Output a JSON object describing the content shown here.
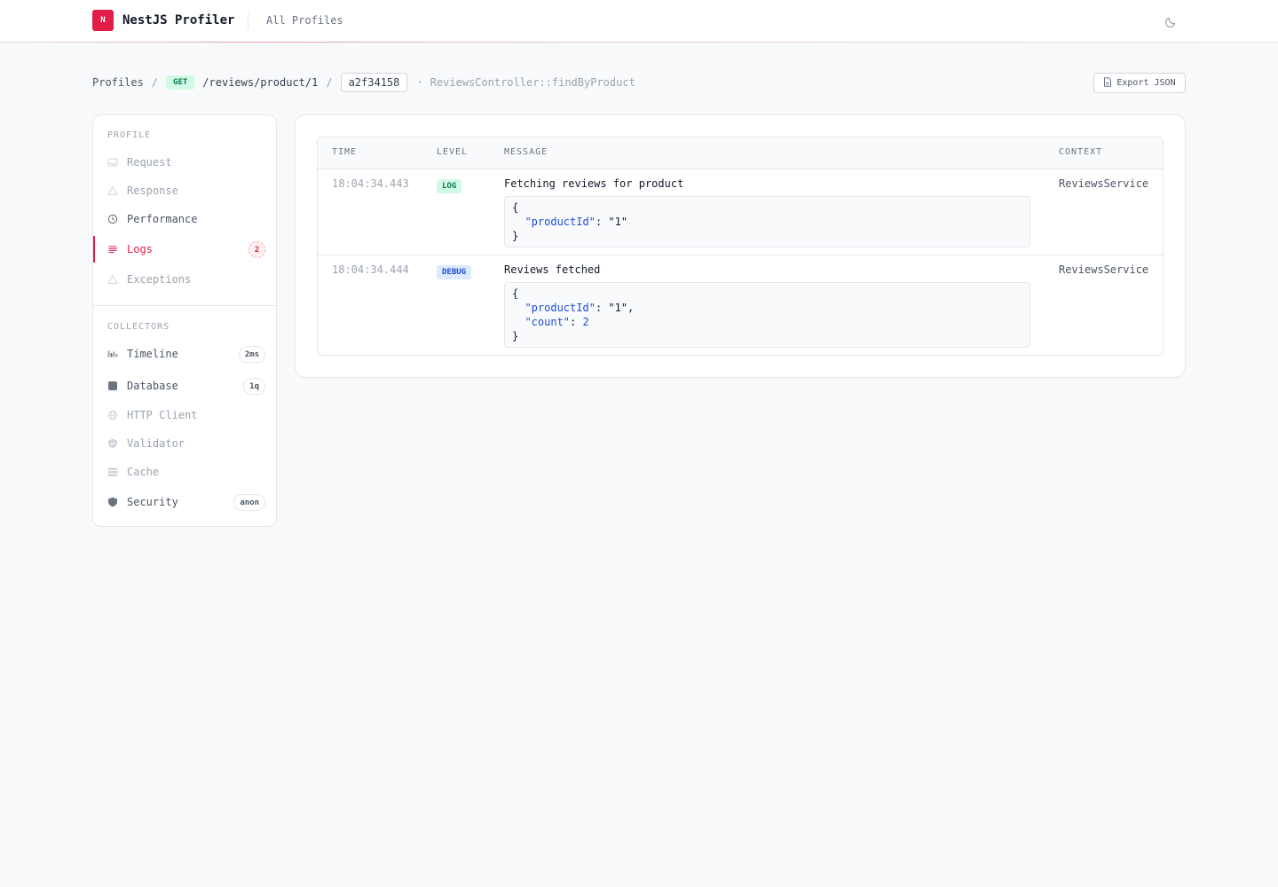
{
  "header": {
    "logo_letter": "N",
    "app_title": "NestJS Profiler",
    "nav_all_profiles": "All Profiles",
    "theme_icon": "moon-icon"
  },
  "breadcrumb": {
    "profiles": "Profiles",
    "sep": "/",
    "method": "GET",
    "path": "/reviews/product/1",
    "token": "a2f34158",
    "dot": "·",
    "handler": "ReviewsController::findByProduct"
  },
  "export_button": {
    "label": "Export JSON",
    "icon": "file-icon"
  },
  "sidebar": {
    "profile_heading": "PROFILE",
    "profile_items": [
      {
        "label": "Request",
        "icon": "inbox-icon"
      },
      {
        "label": "Response",
        "icon": "triangle-icon"
      },
      {
        "label": "Performance",
        "icon": "clock-icon"
      },
      {
        "label": "Logs",
        "icon": "list-icon",
        "badge": "2",
        "active": true
      },
      {
        "label": "Exceptions",
        "icon": "warning-icon"
      }
    ],
    "collectors_heading": "COLLECTORS",
    "collector_items": [
      {
        "label": "Timeline",
        "icon": "timeline-icon",
        "badge": "2ms"
      },
      {
        "label": "Database",
        "icon": "database-icon",
        "badge": "1q"
      },
      {
        "label": "HTTP Client",
        "icon": "globe-icon"
      },
      {
        "label": "Validator",
        "icon": "shield-check-icon"
      },
      {
        "label": "Cache",
        "icon": "layers-icon"
      },
      {
        "label": "Security",
        "icon": "shield-icon",
        "badge": "anon"
      }
    ]
  },
  "logs_table": {
    "columns": [
      "TIME",
      "LEVEL",
      "MESSAGE",
      "CONTEXT"
    ],
    "rows": [
      {
        "time": "18:04:34.443",
        "level": "LOG",
        "message": "Fetching reviews for product",
        "context": "ReviewsService",
        "payload_lines": [
          "{",
          "\"productId\"",
          ": \"1\"",
          "}"
        ]
      },
      {
        "time": "18:04:34.444",
        "level": "DEBUG",
        "message": "Reviews fetched",
        "context": "ReviewsService",
        "payload_lines": [
          "{",
          "\"productId\"",
          ": \"1\",",
          "\"count\"",
          ": ",
          "2",
          "}"
        ]
      }
    ]
  },
  "colors": {
    "accent": "#e11d48",
    "log_badge_bg": "#d1fae5",
    "debug_badge_bg": "#dbeafe"
  }
}
